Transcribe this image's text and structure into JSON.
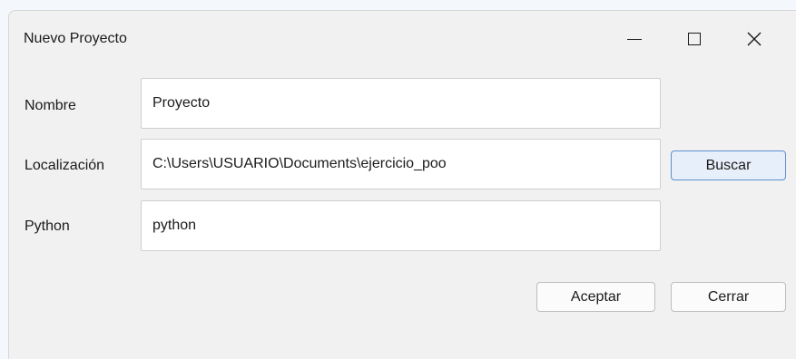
{
  "window": {
    "title": "Nuevo Proyecto"
  },
  "form": {
    "name_label": "Nombre",
    "name_value": "Proyecto",
    "location_label": "Localización",
    "location_value": "C:\\Users\\USUARIO\\Documents\\ejercicio_poo",
    "python_label": "Python",
    "python_value": "python"
  },
  "buttons": {
    "browse": "Buscar",
    "accept": "Aceptar",
    "close": "Cerrar"
  },
  "icons": {
    "minimize": "minimize-icon",
    "maximize": "maximize-icon",
    "close": "close-icon"
  },
  "colors": {
    "accent_border": "#5b8fd0",
    "accent_fill": "#e7effa"
  }
}
